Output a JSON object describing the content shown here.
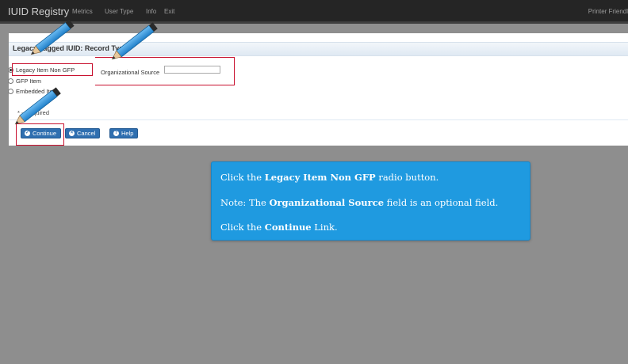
{
  "topbar": {
    "brand": "IUID Registry",
    "nav": [
      "Metrics",
      "User Type",
      "Info",
      "Exit"
    ],
    "printer_friendly": "Printer Friendl"
  },
  "panel": {
    "title": "Legacy Tagged IUID: Record Type"
  },
  "record_types": {
    "options": [
      "Legacy Item Non GFP",
      "GFP Item",
      "Embedded Item"
    ],
    "selected": "Legacy Item Non GFP"
  },
  "org_source": {
    "label": "Organizational Source",
    "value": ""
  },
  "required_note": "* - Required",
  "buttons": {
    "continue": "Continue",
    "cancel": "Cancel",
    "help": "Help"
  },
  "callout": {
    "line1": {
      "pre": "Click the ",
      "bold": "Legacy Item Non GFP",
      "post": " radio button."
    },
    "line2": {
      "pre": "Note: The ",
      "bold": "Organizational Source",
      "post": " field is an optional field."
    },
    "line3": {
      "pre": "Click the ",
      "bold": "Continue",
      "post": " Link."
    }
  },
  "colors": {
    "highlight": "#c8102e",
    "button": "#2f6fb0",
    "callout": "#1f9ae0",
    "topbar": "#252525",
    "pencil": "#2b8fdc"
  }
}
